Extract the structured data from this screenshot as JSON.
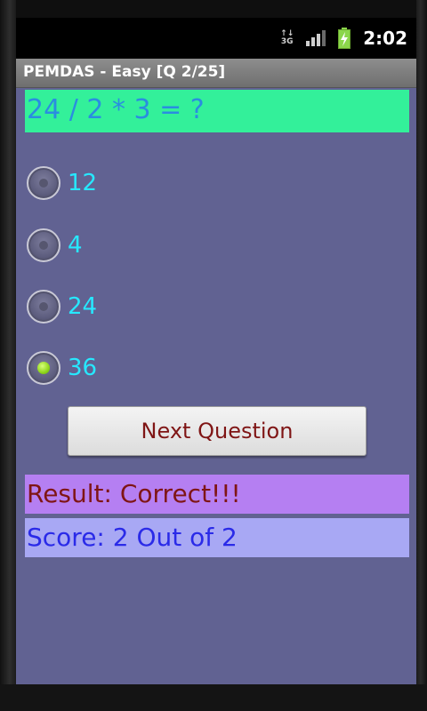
{
  "status_bar": {
    "network": "3G",
    "time": "2:02"
  },
  "app": {
    "title": "PEMDAS - Easy [Q 2/25]"
  },
  "question": {
    "text": "24 / 2 * 3 = ?"
  },
  "options": [
    {
      "label": "12",
      "selected": false
    },
    {
      "label": "4",
      "selected": false
    },
    {
      "label": "24",
      "selected": false
    },
    {
      "label": "36",
      "selected": true
    }
  ],
  "next_button": {
    "label": "Next Question"
  },
  "result": {
    "text": "Result: Correct!!!"
  },
  "score": {
    "text": "Score: 2 Out of 2"
  },
  "colors": {
    "background": "#616292",
    "question_bg": "#33f09a",
    "question_text": "#2a8de0",
    "option_text": "#27e8ff",
    "result_bg": "#b57ff2",
    "result_text": "#7f1515",
    "score_bg": "#a8a8f4",
    "score_text": "#2a2ae8"
  },
  "icons": {
    "network": "network-3g-icon",
    "signal": "signal-strength-icon",
    "battery": "battery-charging-icon"
  }
}
